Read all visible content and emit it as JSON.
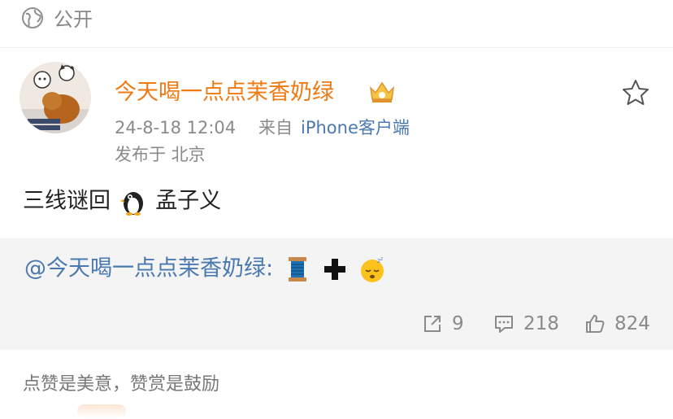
{
  "visibility": {
    "label": "公开",
    "icon": "globe-icon"
  },
  "author": {
    "name": "今天喝一点点茉香奶绿",
    "badge": "crown-badge-icon",
    "avatar": "avatar-image"
  },
  "meta": {
    "time": "24-8-18 12:04",
    "source_prefix": "来自",
    "source": "iPhone客户端",
    "location": "发布于 北京"
  },
  "post": {
    "text_before": "三线谜回",
    "emoji": "penguin-icon",
    "text_after": "孟子义"
  },
  "repost": {
    "mention": "@今天喝一点点茉香奶绿:",
    "emojis": [
      "spool-of-thread-icon",
      "plus-icon",
      "sleeping-face-icon"
    ]
  },
  "actions": {
    "share_count": "9",
    "comment_count": "218",
    "like_count": "824"
  },
  "footer": {
    "note": "点赞是美意，赞赏是鼓励"
  },
  "colors": {
    "username": "#f07a12",
    "link": "#4a78b0",
    "repost_bg": "#f4f4f4"
  }
}
